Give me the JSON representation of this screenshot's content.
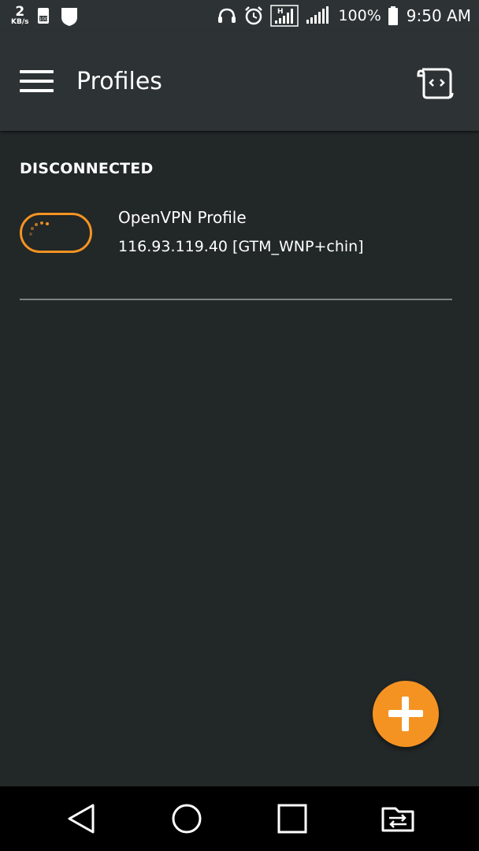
{
  "status_bar": {
    "net_speed_value": "2",
    "net_speed_unit": "KB/s",
    "battery_percent": "100%",
    "time": "9:50 AM",
    "icons": [
      "data-saver-icon",
      "shield-icon",
      "headset-icon",
      "alarm-icon",
      "signal-h-icon",
      "signal-icon",
      "battery-icon"
    ]
  },
  "app_bar": {
    "title": "Profiles",
    "menu_icon": "hamburger-menu-icon",
    "action_icon": "import-script-icon"
  },
  "main": {
    "section_header": "DISCONNECTED",
    "profiles": [
      {
        "name": "OpenVPN Profile",
        "detail": "116.93.119.40 [GTM_WNP+chin]",
        "connected": false
      }
    ],
    "fab_icon": "add-icon"
  },
  "nav_bar": {
    "icons": [
      "back-icon",
      "home-icon",
      "recents-icon",
      "switch-sim-icon"
    ]
  },
  "colors": {
    "accent": "#f59322",
    "background": "#222727",
    "app_bar": "#2d3334",
    "divider": "#7d8282"
  }
}
